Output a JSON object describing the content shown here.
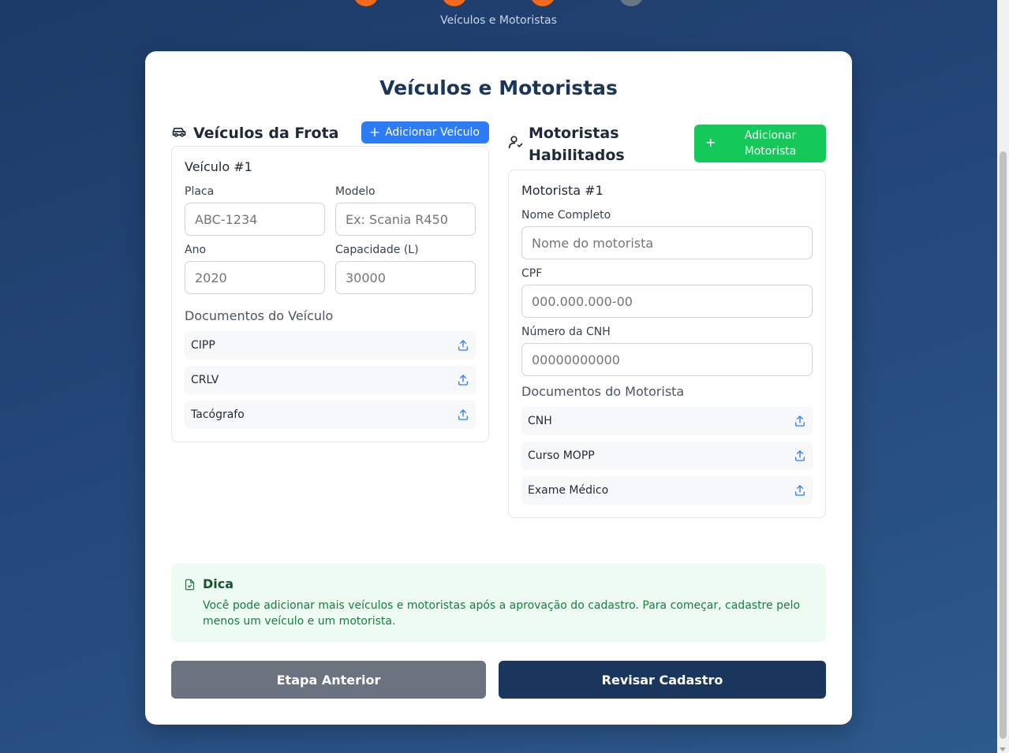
{
  "stepper": {
    "current_label": "Veículos e Motoristas",
    "steps": [
      {
        "state": "done"
      },
      {
        "state": "done"
      },
      {
        "state": "current"
      },
      {
        "state": "pending"
      }
    ],
    "colors": {
      "active": "#f26b1d",
      "inactive": "#687487"
    }
  },
  "card": {
    "title": "Veículos e Motoristas"
  },
  "vehicles": {
    "icon": "car-icon",
    "title": "Veículos da Frota",
    "add_label": "Adicionar Veículo",
    "item": {
      "title": "Veículo #1",
      "fields": {
        "plate": {
          "label": "Placa",
          "placeholder": "ABC-1234"
        },
        "model": {
          "label": "Modelo",
          "placeholder": "Ex: Scania R450"
        },
        "year": {
          "label": "Ano",
          "placeholder": "2020"
        },
        "capacity": {
          "label": "Capacidade (L)",
          "placeholder": "30000"
        }
      },
      "docs_title": "Documentos do Veículo",
      "docs": [
        "CIPP",
        "CRLV",
        "Tacógrafo"
      ]
    }
  },
  "drivers": {
    "icon": "user-check-icon",
    "title_line1": "Motoristas",
    "title_line2": "Habilitados",
    "add_label_line1": "Adicionar",
    "add_label_line2": "Motorista",
    "item": {
      "title": "Motorista #1",
      "fields": {
        "name": {
          "label": "Nome Completo",
          "placeholder": "Nome do motorista"
        },
        "cpf": {
          "label": "CPF",
          "placeholder": "000.000.000-00"
        },
        "cnh": {
          "label": "Número da CNH",
          "placeholder": "00000000000"
        }
      },
      "docs_title": "Documentos do Motorista",
      "docs": [
        "CNH",
        "Curso MOPP",
        "Exame Médico"
      ]
    }
  },
  "tip": {
    "icon": "file-check-icon",
    "title": "Dica",
    "text": "Você pode adicionar mais veículos e motoristas após a aprovação do cadastro. Para começar, cadastre pelo menos um veículo e um motorista."
  },
  "actions": {
    "prev_label": "Etapa Anterior",
    "next_label": "Revisar Cadastro"
  },
  "colors": {
    "primary": "#1b365d",
    "blue": "#2d7cf6",
    "green": "#14c85a",
    "gray_button": "#6b7280"
  }
}
